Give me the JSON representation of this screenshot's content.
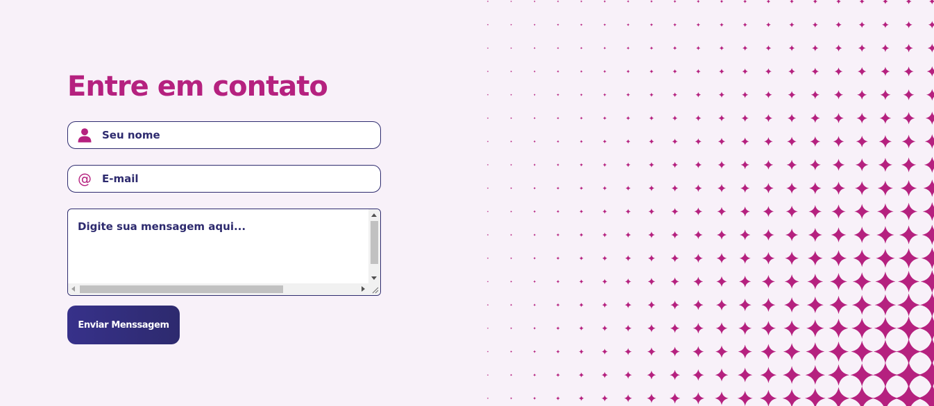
{
  "contact": {
    "title": "Entre em contato",
    "name_placeholder": "Seu nome",
    "email_placeholder": "E-mail",
    "message_placeholder": "Digite sua mensagem aqui...",
    "submit_label": "Enviar Menssagem"
  },
  "icons": {
    "name": "person-icon",
    "email": "at-sign-icon",
    "decoration": "four-point-star-icon"
  },
  "colors": {
    "background": "#f8f1f9",
    "accent": "#b5217f",
    "navy": "#2d2a6e",
    "button": "#33307c"
  }
}
